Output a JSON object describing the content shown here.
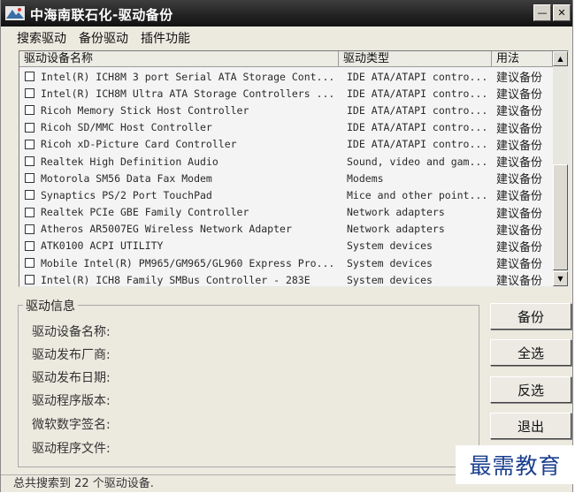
{
  "window": {
    "title": "中海南联石化-驱动备份"
  },
  "menu": [
    "搜索驱动",
    "备份驱动",
    "插件功能"
  ],
  "list": {
    "columns": [
      "驱动设备名称",
      "驱动类型",
      "用法"
    ],
    "rows": [
      {
        "name": "Intel(R) ICH8M 3 port Serial ATA Storage Cont...",
        "type": "IDE ATA/ATAPI contro...",
        "recommend": "建议备份"
      },
      {
        "name": "Intel(R) ICH8M Ultra ATA Storage Controllers ...",
        "type": "IDE ATA/ATAPI contro...",
        "recommend": "建议备份"
      },
      {
        "name": "Ricoh Memory Stick Host Controller",
        "type": "IDE ATA/ATAPI contro...",
        "recommend": "建议备份"
      },
      {
        "name": "Ricoh SD/MMC Host Controller",
        "type": "IDE ATA/ATAPI contro...",
        "recommend": "建议备份"
      },
      {
        "name": "Ricoh xD-Picture Card Controller",
        "type": "IDE ATA/ATAPI contro...",
        "recommend": "建议备份"
      },
      {
        "name": "Realtek High Definition Audio",
        "type": "Sound, video and gam...",
        "recommend": "建议备份"
      },
      {
        "name": "Motorola SM56 Data Fax Modem",
        "type": "Modems",
        "recommend": "建议备份"
      },
      {
        "name": "Synaptics PS/2 Port TouchPad",
        "type": "Mice and other point...",
        "recommend": "建议备份"
      },
      {
        "name": "Realtek PCIe GBE Family Controller",
        "type": "Network adapters",
        "recommend": "建议备份"
      },
      {
        "name": "Atheros AR5007EG Wireless Network Adapter",
        "type": "Network adapters",
        "recommend": "建议备份"
      },
      {
        "name": "ATK0100 ACPI UTILITY",
        "type": "System devices",
        "recommend": "建议备份"
      },
      {
        "name": "Mobile Intel(R) PM965/GM965/GL960 Express Pro...",
        "type": "System devices",
        "recommend": "建议备份"
      },
      {
        "name": "Intel(R) ICH8 Family SMBus Controller - 283E",
        "type": "System devices",
        "recommend": "建议备份"
      }
    ]
  },
  "info": {
    "title": "驱动信息",
    "fields": [
      "驱动设备名称:",
      "驱动发布厂商:",
      "驱动发布日期:",
      "驱动程序版本:",
      "微软数字签名:",
      "驱动程序文件:"
    ]
  },
  "buttons": {
    "backup": "备份",
    "select_all": "全选",
    "invert": "反选",
    "exit": "退出"
  },
  "status": "总共搜索到 22 个驱动设备.",
  "watermark": "最需教育",
  "colors": {
    "titlebar": "#242424",
    "window_bg": "#ece9df",
    "watermark": "#1b3f8f"
  }
}
